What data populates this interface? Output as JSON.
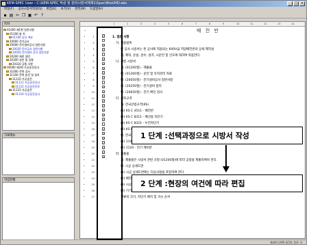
{
  "window": {
    "title": "KEM-SPEC User - C:\\KEM-SPEC 작성 및 관리시방서체계1\\Spec\\BtoUHD.eks"
  },
  "menu": {
    "items": [
      "파일(F)",
      "공사시방서작성(S)",
      "편집(E)",
      "보기(V)",
      "관리(M)",
      "도움말(H)"
    ]
  },
  "toolbar": {
    "buttons": [
      "save",
      "print",
      "cut",
      "copy",
      "paste",
      "undo",
      "help"
    ]
  },
  "left_panel": {
    "tree_header": "목차",
    "tree": [
      {
        "label": "01000 제1편 일반사항",
        "blue": false,
        "indent": 0
      },
      {
        "label": "01100 총 칙",
        "blue": false,
        "indent": 1
      },
      {
        "label": "01100 공사 개요",
        "blue": true,
        "indent": 2
      },
      {
        "label": "20000 전기공사",
        "blue": false,
        "indent": 1
      },
      {
        "label": "20000 전기설비공사 일반사항",
        "blue": false,
        "indent": 1
      },
      {
        "label": "20020 전기공사 일반사항",
        "blue": true,
        "indent": 2
      },
      {
        "label": "20050 전기설비 공사 일반사항",
        "blue": true,
        "indent": 2
      },
      {
        "label": "20200 재료 일반",
        "blue": false,
        "indent": 1
      },
      {
        "label": "20300 일반 및 공통",
        "blue": false,
        "indent": 1
      },
      {
        "label": "20310 공통 사항",
        "blue": false,
        "indent": 2
      },
      {
        "label": "30000 제3편 가공송전공사",
        "blue": false,
        "indent": 0
      },
      {
        "label": "31000 전력 공사",
        "blue": false,
        "indent": 1
      },
      {
        "label": "31100 전력 송전 및 설치",
        "blue": false,
        "indent": 1
      },
      {
        "label": "31110 가공송전",
        "blue": false,
        "indent": 2
      },
      {
        "label": "31111 가공송전공사",
        "blue": true,
        "indent": 3
      },
      {
        "label": "31112 가공송전선로",
        "blue": true,
        "indent": 3
      },
      {
        "label": "31115 가공송전",
        "blue": false,
        "indent": 2
      },
      {
        "label": "31116 가공송전공사",
        "blue": true,
        "indent": 3
      }
    ],
    "panel2_header": "가로메뉴",
    "panel3_header": "작업현황"
  },
  "document": {
    "ruler": [
      "1",
      "2",
      "3",
      "4",
      "5",
      "6",
      "7",
      "8",
      "9",
      "10",
      "11",
      "12",
      "13",
      "14"
    ],
    "title": "배 전 반",
    "lines": [
      {
        "text": "1. 일반 사항",
        "level": 1,
        "checked": true
      },
      {
        "text": "가. 적용범위",
        "level": 2,
        "checked": false
      },
      {
        "text": "본 공사 시방서는 본 공사에 적용되는 600V급 저압배전반의 상세 제작설",
        "level": 3,
        "checked": true
      },
      {
        "text": "계, 제작, 운송, 검수, 설치, 시운전 및 인도에 대하여 적용한다.",
        "level": 3,
        "checked": true
      },
      {
        "text": "나. 관련 시방서",
        "level": 2,
        "checked": false
      },
      {
        "text": "가. (01200절) - 제출물",
        "level": 3,
        "checked": true
      },
      {
        "text": "나. (01300절) - 운전 및 유지관리 자료",
        "level": 3,
        "checked": true
      },
      {
        "text": "다. (20050절) - 전기설비공사 일반사항",
        "level": 3,
        "checked": true
      },
      {
        "text": "라. (20250절) - 전기설비 접지",
        "level": 3,
        "checked": true
      },
      {
        "text": "마. (20650절) - 전기 확인 검사",
        "level": 3,
        "checked": true
      },
      {
        "text": "다. 참조규격",
        "level": 2,
        "checked": false
      },
      {
        "text": "가. 한국산업규격(KS)",
        "level": 3,
        "checked": true
      },
      {
        "text": "(1) KS C 4511 - 배전반",
        "level": 3,
        "checked": true
      },
      {
        "text": "(2) KS C 8311 - 배선용 차단기",
        "level": 3,
        "checked": true
      },
      {
        "text": "(3) KS C 8321 - 누전차단기",
        "level": 3,
        "checked": true
      },
      {
        "text": "(4) KS C 3812 - 전기 설선 공선 및 규격",
        "level": 3,
        "checked": true
      },
      {
        "text": "나. 한국전기공업협동조합 표준규격(KEMC)",
        "level": 3,
        "checked": true
      },
      {
        "text": "(1) 1107 - 저압 배전 배전반",
        "level": 3,
        "checked": true
      },
      {
        "text": "(2) 1120 - 전기 제어반",
        "level": 3,
        "checked": true
      },
      {
        "text": "라. 제출물",
        "level": 2,
        "checked": false
      },
      {
        "text": "가. 제출물은 시방서 관련 규정 (01200절)에 따라 공정을 제출하여야 한다.",
        "level": 3,
        "checked": true
      },
      {
        "text": "나. 시공 상세도면",
        "level": 3,
        "checked": true
      },
      {
        "text": "(1) 시공 상세도면에는 다음사항을 포함하여 한다.",
        "level": 3,
        "checked": true
      },
      {
        "text": "(2) 배전반 설치 상세도 및 내부결선도",
        "level": 3,
        "checked": true
      },
      {
        "text": "(3) 시공 상세도",
        "level": 3,
        "checked": true
      },
      {
        "text": "(4) 기기의 상세도, 치치업 치수, 전압, 주 Bus의 정류용량, 전체 단락",
        "level": 3,
        "checked": true
      },
      {
        "text": "전류의 크기, 차단기 배치 및 거시 순서",
        "level": 3,
        "checked": true
      }
    ]
  },
  "annotations": {
    "step1": "1 단계 :선택과정으로 시방서 작성",
    "step2": "2 단계 :현장의 여건에 따라 편집"
  },
  "statusbar": {
    "text": "NUM  CAPS  SCRL  전로: 0"
  }
}
